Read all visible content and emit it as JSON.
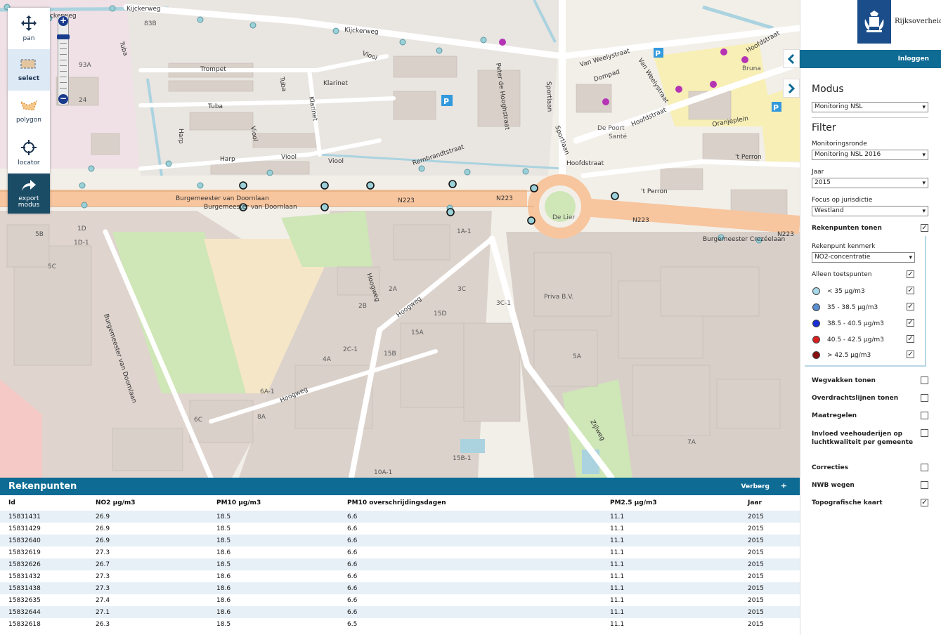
{
  "toolbar": {
    "tools": [
      {
        "label": "pan"
      },
      {
        "label": "select"
      },
      {
        "label": "polygon"
      },
      {
        "label": "locator"
      },
      {
        "label": "export modus"
      }
    ]
  },
  "zoom": {
    "plus": "+",
    "minus": "−"
  },
  "map": {
    "street_labels": [
      "Kijckerweg",
      "Kijckerweg",
      "Kijckerweg",
      "Trompet",
      "Tuba",
      "Tuba",
      "Tuba",
      "Klarinet",
      "Klarinet",
      "Viool",
      "Viool",
      "Viool",
      "Viool",
      "Harp",
      "Harp",
      "Rembrandtstraat",
      "Peter de Hooghstraat",
      "Sportlaan",
      "Sportlaan",
      "Dompad",
      "Van Weelystraat",
      "Van Weelystraat",
      "Hoofdstraat",
      "Hoofdstraat",
      "Hoofdstraat",
      "Oranjeplein",
      "'t Perron",
      "'t Perron",
      "Burgemeester van Doornlaan",
      "Burgemeester van Doornlaan",
      "Burgemeester van Doornlaan",
      "Burgemeester Crezéelaan",
      "Hoogweg",
      "Hoogweg",
      "Hoogweg",
      "Zijlweg",
      "N223",
      "N223",
      "N223",
      "N223",
      "De Lier",
      "De Poort",
      "Santé",
      "Bruna",
      "Priva B.V."
    ],
    "house_numbers": [
      "93A",
      "83B",
      "24",
      "1D",
      "1D-1",
      "5B",
      "5C",
      "2A",
      "2B",
      "2C-1",
      "4A",
      "6A-1",
      "8A",
      "6C",
      "3C",
      "3C-1",
      "15A",
      "15B",
      "15D",
      "1A-1",
      "5A",
      "7A",
      "10A-1",
      "15B-1"
    ]
  },
  "header": {
    "logo_text": "Rijksoverheid",
    "login": "Inloggen"
  },
  "sidebar": {
    "modus_heading": "Modus",
    "modus_value": "Monitoring NSL",
    "filter_heading": "Filter",
    "monitoringsronde_label": "Monitoringsronde",
    "monitoringsronde_value": "Monitoring NSL 2016",
    "jaar_label": "Jaar",
    "jaar_value": "2015",
    "focus_label": "Focus op jurisdictie",
    "focus_value": "Westland",
    "rekenpunten_tonen": {
      "label": "Rekenpunten tonen",
      "checked": true
    },
    "kenmerk_label": "Rekenpunt kenmerk",
    "kenmerk_value": "NO2-concentratie",
    "alleen_toetspunten": {
      "label": "Alleen toetspunten",
      "checked": true
    },
    "legend": [
      {
        "label": "< 35 µg/m3",
        "color": "#a8d8e8",
        "checked": true
      },
      {
        "label": "35 - 38.5 µg/m3",
        "color": "#5a8fd0",
        "checked": true
      },
      {
        "label": "38.5 - 40.5 µg/m3",
        "color": "#1a2ed8",
        "checked": true
      },
      {
        "label": "40.5 - 42.5 µg/m3",
        "color": "#d82020",
        "checked": true
      },
      {
        "label": "> 42.5 µg/m3",
        "color": "#8a1010",
        "checked": true
      }
    ],
    "layers": [
      {
        "label": "Wegvakken tonen",
        "checked": false
      },
      {
        "label": "Overdrachtslijnen tonen",
        "checked": false
      },
      {
        "label": "Maatregelen",
        "checked": false
      },
      {
        "label": "Invloed veehouderijen op luchtkwaliteit per gemeente",
        "checked": false
      },
      {
        "label": "Correcties",
        "checked": false
      },
      {
        "label": "NWB wegen",
        "checked": false
      },
      {
        "label": "Topografische kaart",
        "checked": true
      }
    ]
  },
  "panel": {
    "title": "Rekenpunten",
    "hide": "Verberg",
    "plus": "+",
    "columns": [
      "Id",
      "NO2 µg/m3",
      "PM10 µg/m3",
      "PM10 overschrijdingsdagen",
      "PM2.5 µg/m3",
      "Jaar"
    ],
    "rows": [
      [
        "15831431",
        "26.9",
        "18.5",
        "6.6",
        "11.1",
        "2015"
      ],
      [
        "15831429",
        "26.9",
        "18.5",
        "6.6",
        "11.1",
        "2015"
      ],
      [
        "15832640",
        "26.9",
        "18.5",
        "6.6",
        "11.1",
        "2015"
      ],
      [
        "15832619",
        "27.3",
        "18.6",
        "6.6",
        "11.1",
        "2015"
      ],
      [
        "15832626",
        "26.7",
        "18.5",
        "6.6",
        "11.1",
        "2015"
      ],
      [
        "15831432",
        "27.3",
        "18.6",
        "6.6",
        "11.1",
        "2015"
      ],
      [
        "15831438",
        "27.3",
        "18.6",
        "6.6",
        "11.1",
        "2015"
      ],
      [
        "15832635",
        "27.4",
        "18.6",
        "6.6",
        "11.1",
        "2015"
      ],
      [
        "15832644",
        "27.1",
        "18.6",
        "6.6",
        "11.1",
        "2015"
      ],
      [
        "15832618",
        "26.3",
        "18.5",
        "6.5",
        "11.1",
        "2015"
      ]
    ]
  }
}
